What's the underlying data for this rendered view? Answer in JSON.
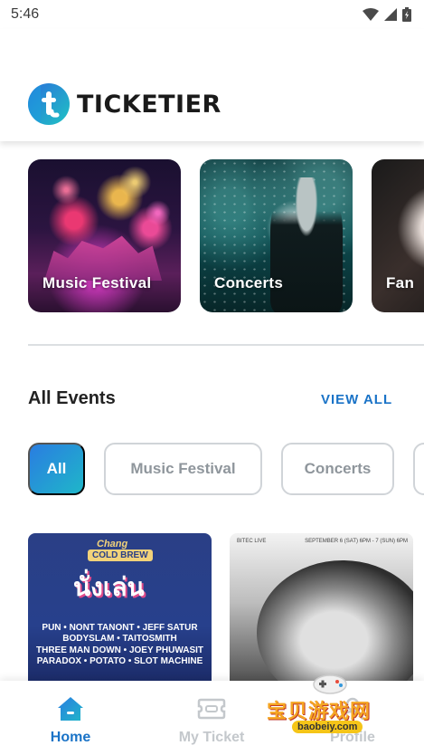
{
  "status_bar": {
    "time": "5:46"
  },
  "header": {
    "brand": "TICKETIER",
    "logo_letter": "t"
  },
  "categories": [
    {
      "label": "Music Festival"
    },
    {
      "label": "Concerts"
    },
    {
      "label": "Fan"
    }
  ],
  "events_section": {
    "title": "All Events",
    "view_all": "VIEW ALL"
  },
  "filters": [
    {
      "label": "All",
      "active": true
    },
    {
      "label": "Music Festival",
      "active": false
    },
    {
      "label": "Concerts",
      "active": false
    }
  ],
  "events": [
    {
      "brand": "Chang",
      "sub": "COLD BREW",
      "lineup": [
        "PUN • NONT TANONT • JEFF SATUR",
        "BODYSLAM • TAITOSMITH",
        "THREE MAN DOWN • JOEY PHUWASIT",
        "PARADOX • POTATO • SLOT MACHINE"
      ]
    },
    {
      "top_left": "BITEC LIVE",
      "top_right": "SEPTEMBER 6 (SAT) 6PM - 7 (SUN) 6PM"
    }
  ],
  "bottom_nav": [
    {
      "label": "Home",
      "icon": "home-icon",
      "active": true
    },
    {
      "label": "My Ticket",
      "icon": "ticket-icon",
      "active": false
    },
    {
      "label": "Profile",
      "icon": "profile-icon",
      "active": false
    }
  ],
  "watermark": {
    "text": "宝贝游戏网",
    "url": "baobeiy.com"
  },
  "colors": {
    "accent": "#1a73c7",
    "chip_gradient_start": "#2a7de1",
    "chip_gradient_end": "#1fb6c9",
    "inactive": "#c4c8cc"
  }
}
